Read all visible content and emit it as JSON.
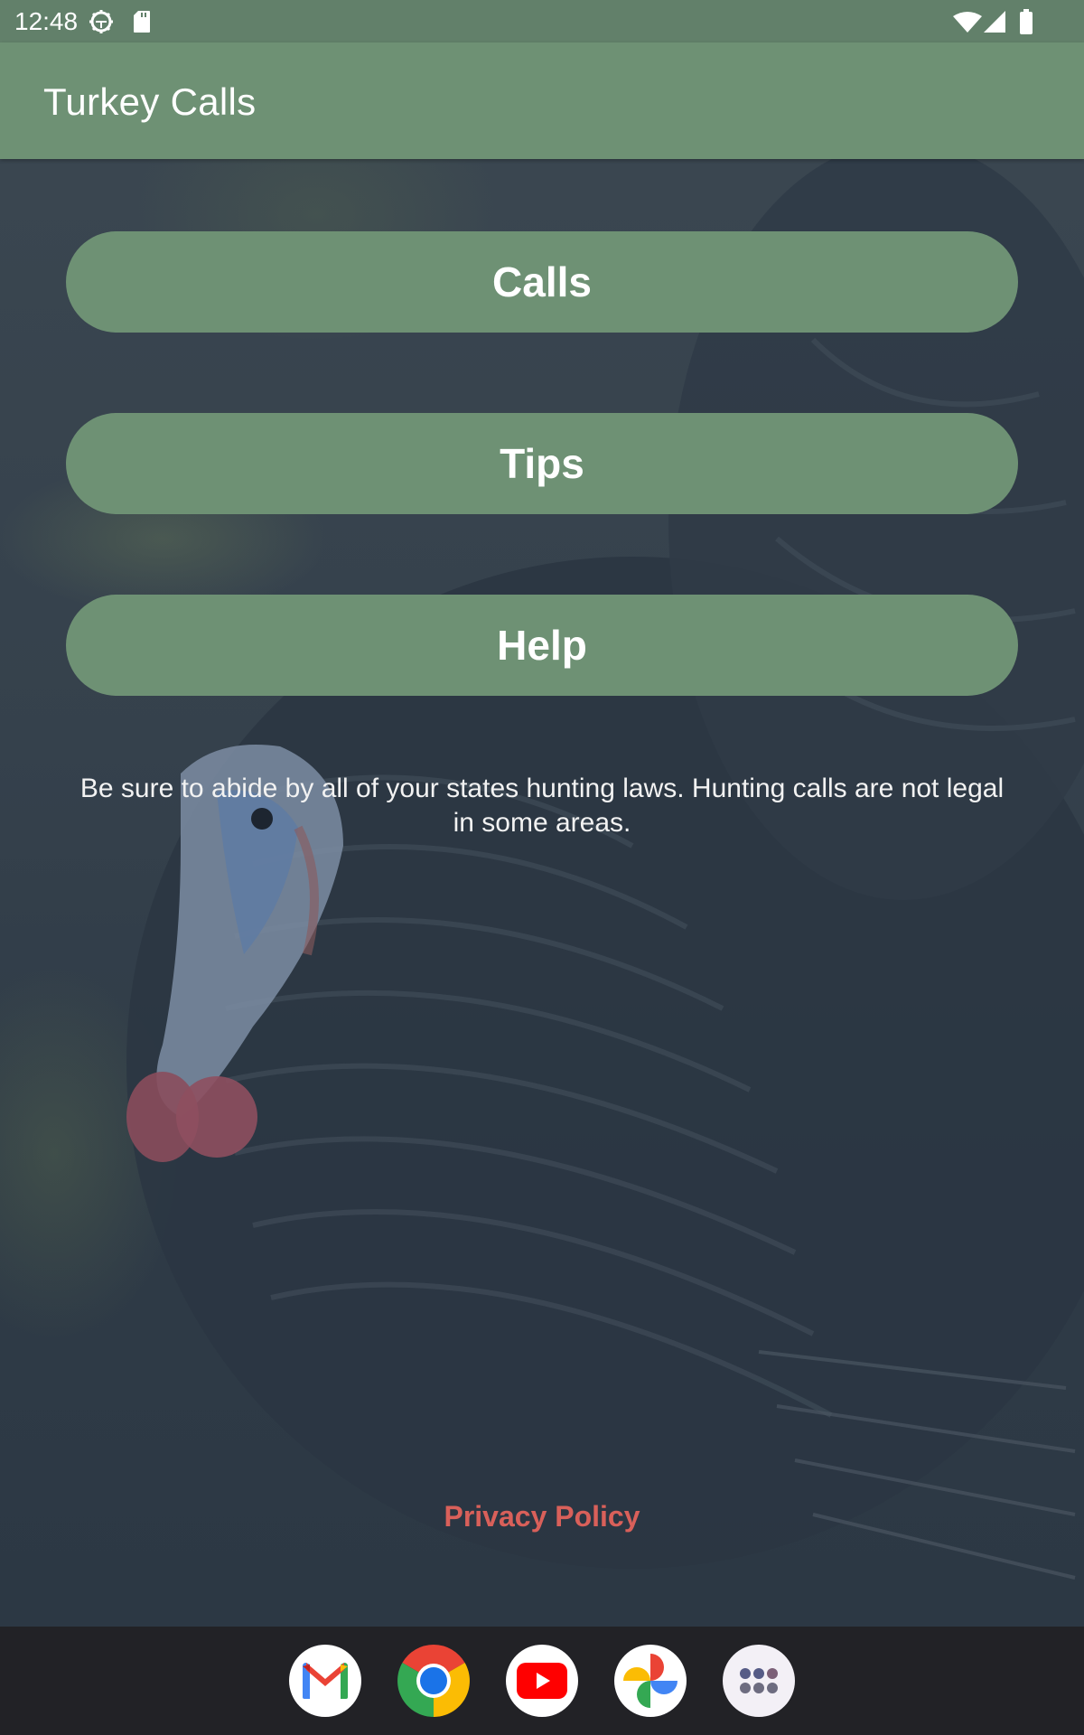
{
  "status_bar": {
    "time": "12:48",
    "left_icons": [
      "android-debug-icon",
      "sd-card-icon"
    ],
    "right_icons": [
      "wifi-icon",
      "cell-signal-icon",
      "battery-icon"
    ]
  },
  "app_bar": {
    "title": "Turkey Calls"
  },
  "menu": {
    "buttons": [
      {
        "label": "Calls"
      },
      {
        "label": "Tips"
      },
      {
        "label": "Help"
      }
    ]
  },
  "notice": "Be sure to abide by all of your states hunting laws. Hunting calls are not legal in some areas.",
  "privacy_link": "Privacy Policy",
  "colors": {
    "primary": "#6e9174",
    "status_bar": "#62806a",
    "link": "#d9605a",
    "dock": "#222226"
  },
  "dock": {
    "apps": [
      {
        "name": "Gmail",
        "icon": "gmail-icon"
      },
      {
        "name": "Chrome",
        "icon": "chrome-icon"
      },
      {
        "name": "YouTube",
        "icon": "youtube-icon"
      },
      {
        "name": "Photos",
        "icon": "photos-icon"
      },
      {
        "name": "App drawer",
        "icon": "app-drawer-icon"
      }
    ]
  }
}
